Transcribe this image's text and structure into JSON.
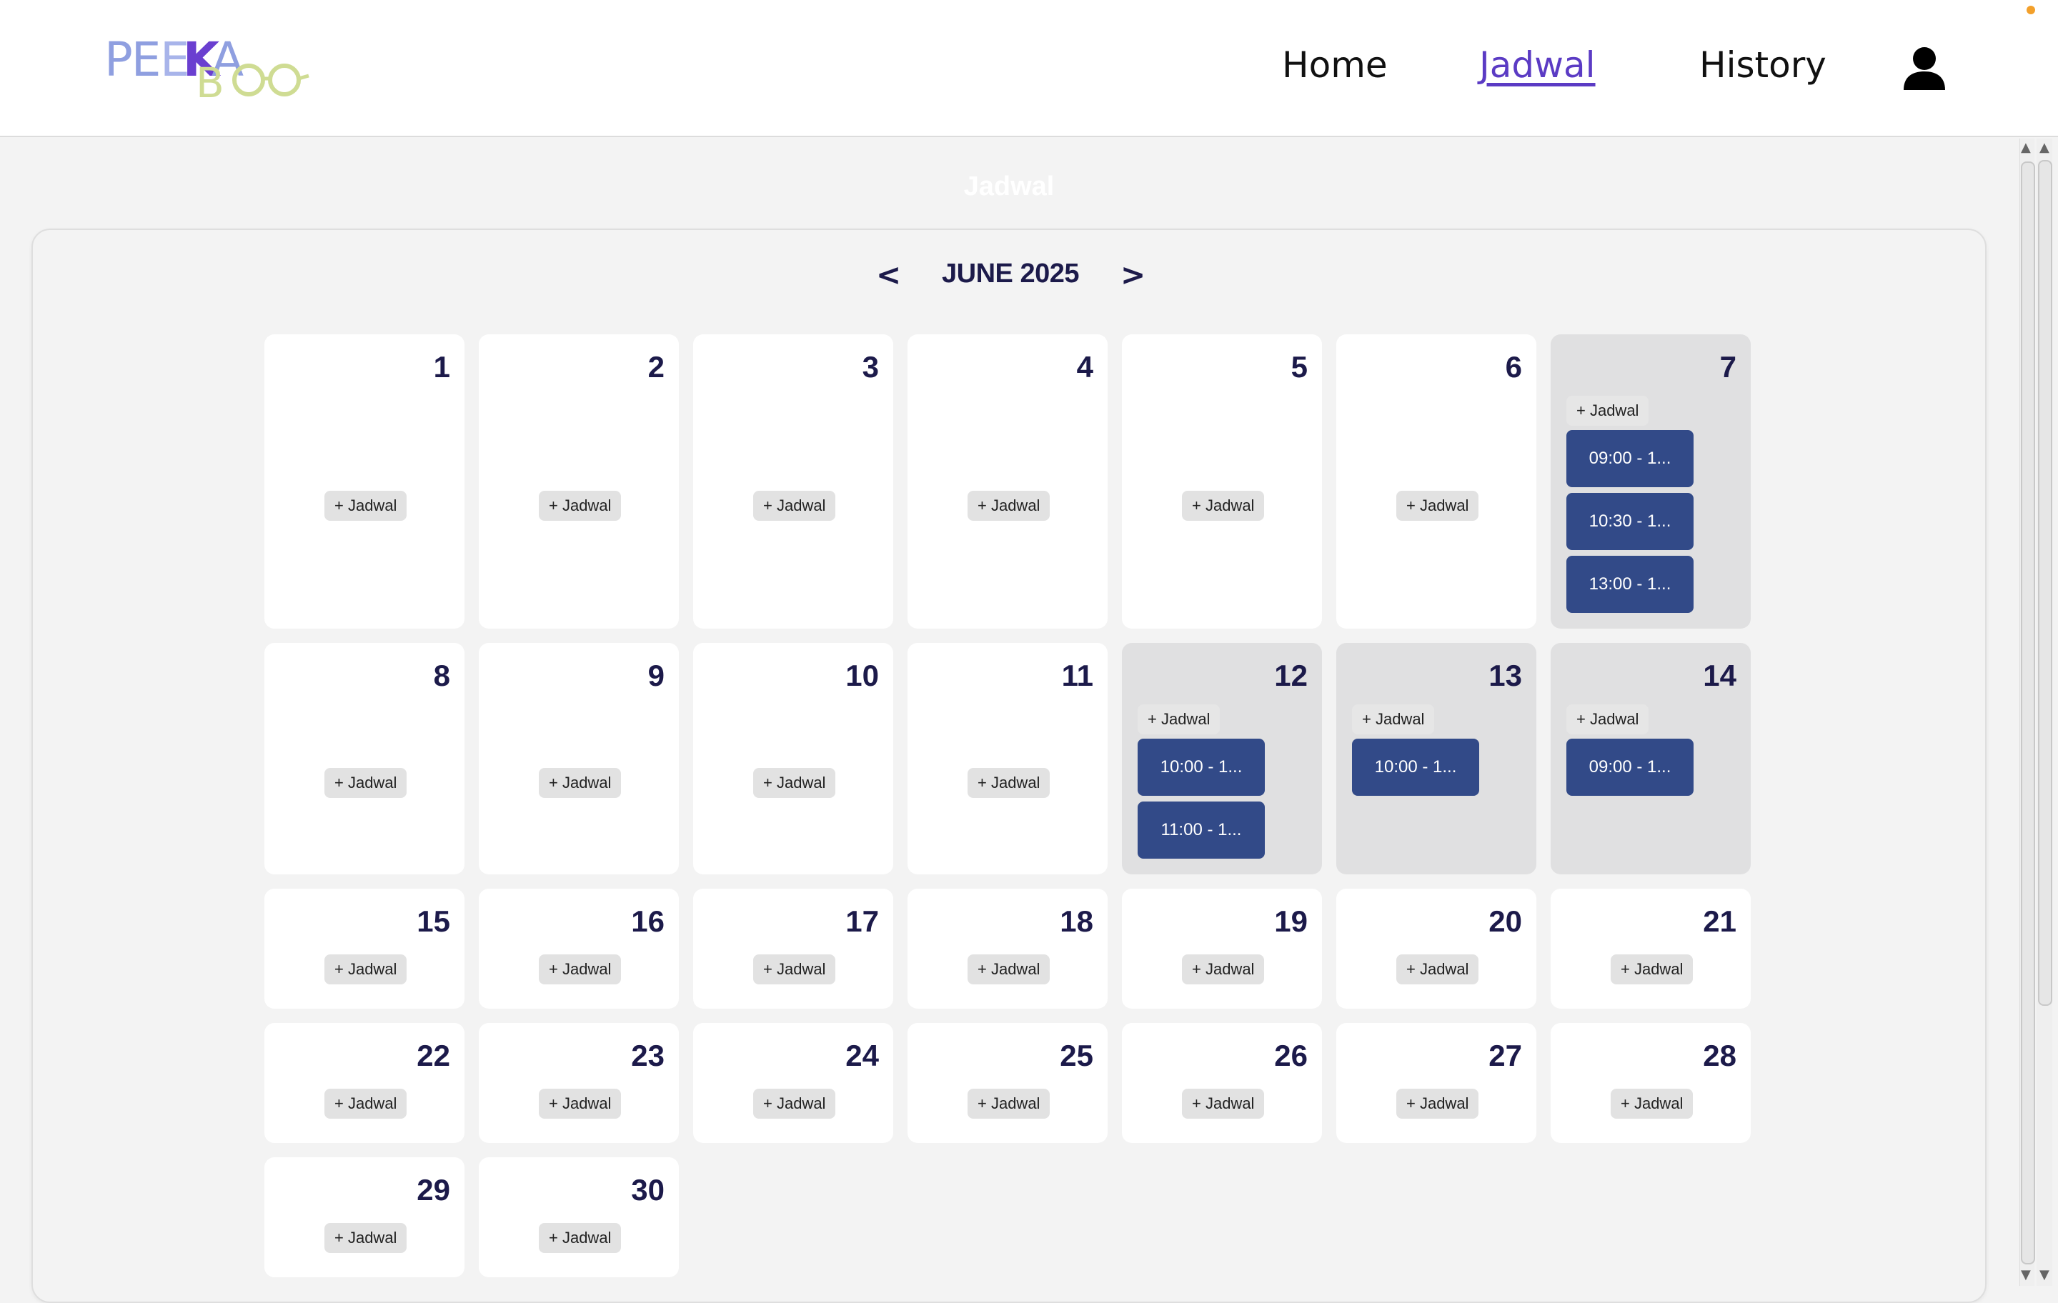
{
  "header": {
    "logo_text": "PEEKABOO",
    "nav": {
      "home": "Home",
      "jadwal": "Jadwal",
      "history": "History"
    },
    "active": "Jadwal"
  },
  "page": {
    "title": "Jadwal"
  },
  "calendar": {
    "month_label": "JUNE 2025",
    "prev": "<",
    "next": ">",
    "add_label": "+ Jadwal",
    "days": [
      {
        "day": "1",
        "events": []
      },
      {
        "day": "2",
        "events": []
      },
      {
        "day": "3",
        "events": []
      },
      {
        "day": "4",
        "events": []
      },
      {
        "day": "5",
        "events": []
      },
      {
        "day": "6",
        "events": []
      },
      {
        "day": "7",
        "events": [
          "09:00 - 1...",
          "10:30 - 1...",
          "13:00 - 1..."
        ]
      },
      {
        "day": "8",
        "events": []
      },
      {
        "day": "9",
        "events": []
      },
      {
        "day": "10",
        "events": []
      },
      {
        "day": "11",
        "events": []
      },
      {
        "day": "12",
        "events": [
          "10:00 - 1...",
          "11:00 - 1..."
        ]
      },
      {
        "day": "13",
        "events": [
          "10:00 - 1..."
        ]
      },
      {
        "day": "14",
        "events": [
          "09:00 - 1..."
        ]
      },
      {
        "day": "15",
        "events": []
      },
      {
        "day": "16",
        "events": []
      },
      {
        "day": "17",
        "events": []
      },
      {
        "day": "18",
        "events": []
      },
      {
        "day": "19",
        "events": []
      },
      {
        "day": "20",
        "events": []
      },
      {
        "day": "21",
        "events": []
      },
      {
        "day": "22",
        "events": []
      },
      {
        "day": "23",
        "events": []
      },
      {
        "day": "24",
        "events": []
      },
      {
        "day": "25",
        "events": []
      },
      {
        "day": "26",
        "events": []
      },
      {
        "day": "27",
        "events": []
      },
      {
        "day": "28",
        "events": []
      },
      {
        "day": "29",
        "events": []
      },
      {
        "day": "30",
        "events": []
      }
    ]
  },
  "colors": {
    "accent": "#5b3bc4",
    "event_bg": "#324a88",
    "day_num": "#1c1a4a",
    "day_with_events_bg": "#e0e0e1",
    "indicator_dot": "#f3a02b"
  },
  "icons": {
    "user": "user-icon"
  }
}
